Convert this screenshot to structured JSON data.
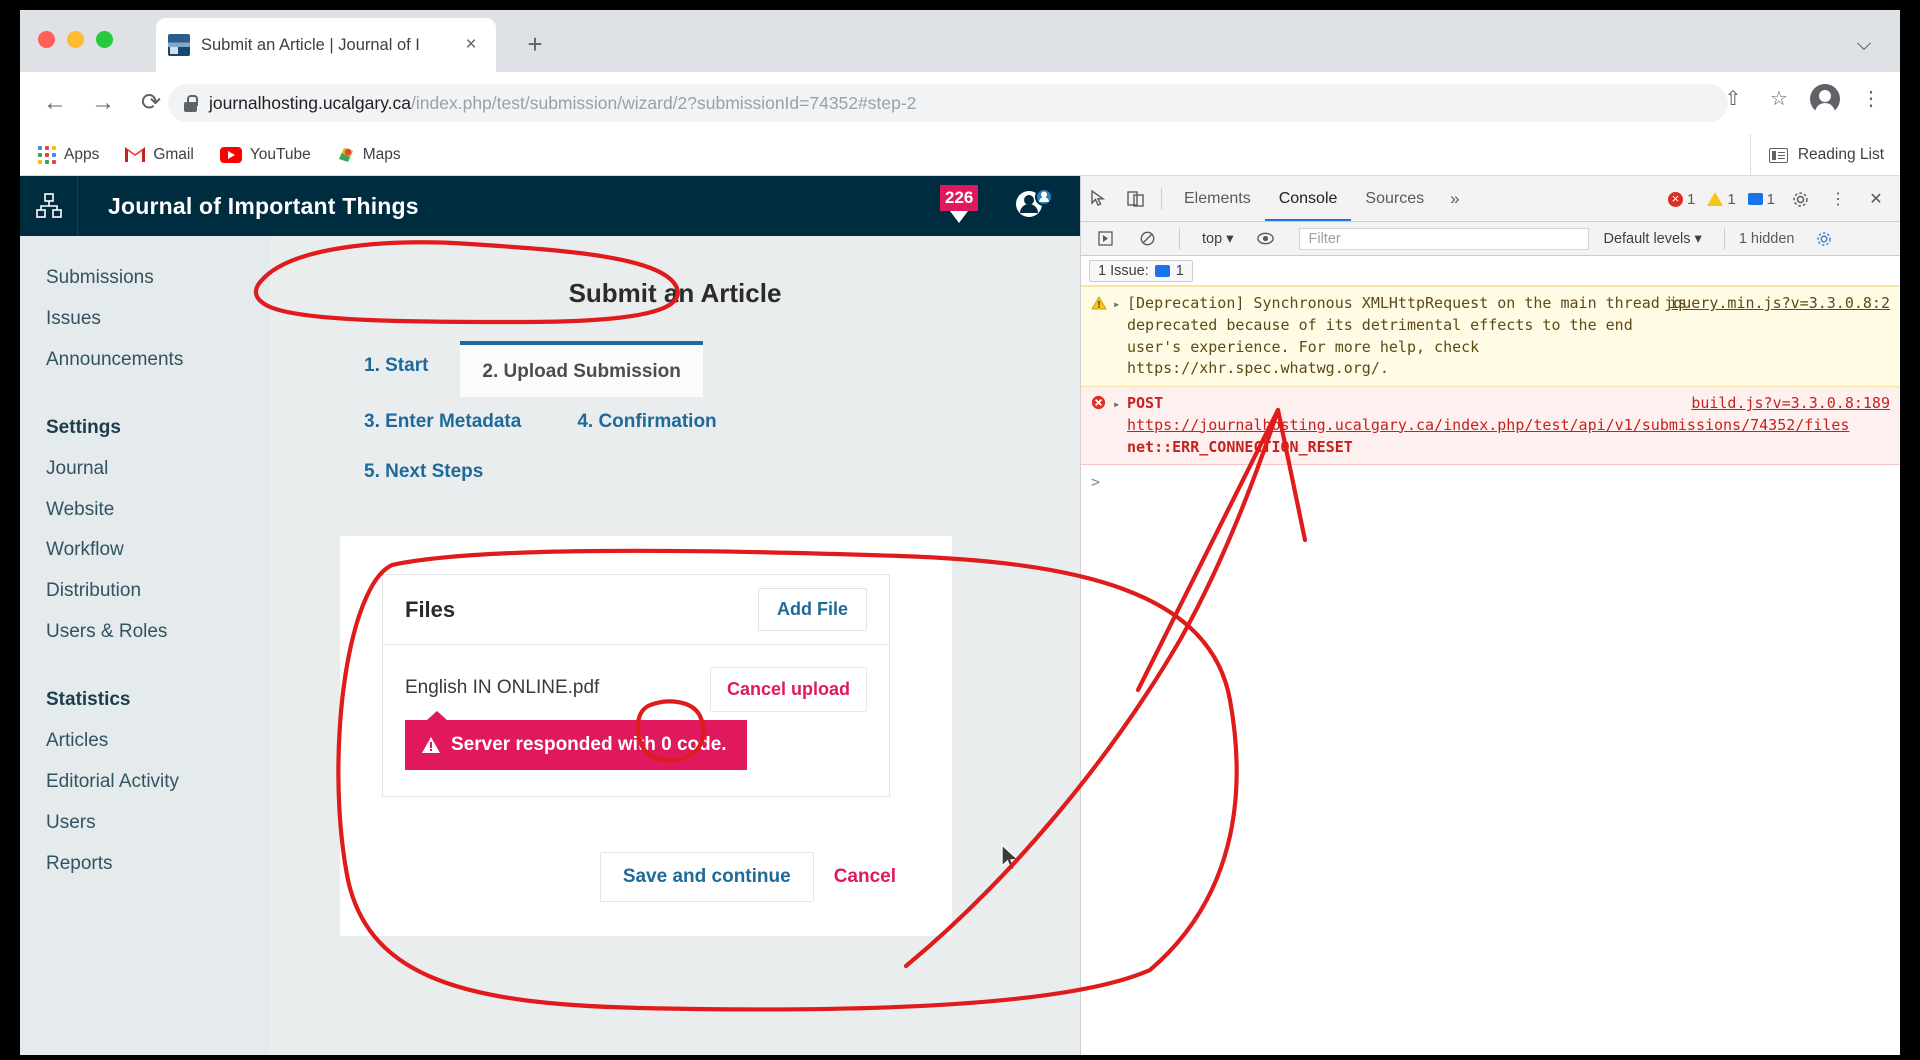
{
  "browser": {
    "tab": {
      "title": "Submit an Article | Journal of I",
      "favicon_name": "site-favicon",
      "close_label": "×"
    },
    "new_tab_label": "+",
    "tabstrip_chevron": "⌵",
    "nav": {
      "back": "←",
      "forward": "→",
      "reload": "⟳"
    },
    "url": {
      "host": "journalhosting.ucalgary.ca",
      "path": "/index.php/test/submission/wizard/2?submissionId=74352#step-2",
      "full": "journalhosting.ucalgary.ca/index.php/test/submission/wizard/2?submissionId=74352#step-2"
    },
    "toolbar_icons": {
      "share": "⇧",
      "bookmark": "☆",
      "menu": "⋮",
      "profile_name": "profile-avatar"
    },
    "bookmarks": [
      {
        "label": "Apps",
        "icon": "apps-grid-icon"
      },
      {
        "label": "Gmail",
        "icon": "gmail-icon"
      },
      {
        "label": "YouTube",
        "icon": "youtube-icon"
      },
      {
        "label": "Maps",
        "icon": "maps-icon"
      }
    ],
    "reading_list": {
      "label": "Reading List",
      "icon": "reading-list-icon"
    }
  },
  "ojs": {
    "header": {
      "logo_name": "ojs-logo-icon",
      "title": "Journal of Important Things",
      "notifications_count": "226",
      "user_icon_name": "user-account-icon"
    },
    "sidebar": [
      {
        "type": "item",
        "label": "Submissions"
      },
      {
        "type": "item",
        "label": "Issues"
      },
      {
        "type": "item",
        "label": "Announcements"
      },
      {
        "type": "gap"
      },
      {
        "type": "head",
        "label": "Settings"
      },
      {
        "type": "item",
        "label": "Journal"
      },
      {
        "type": "item",
        "label": "Website"
      },
      {
        "type": "item",
        "label": "Workflow"
      },
      {
        "type": "item",
        "label": "Distribution"
      },
      {
        "type": "item",
        "label": "Users & Roles"
      },
      {
        "type": "gap"
      },
      {
        "type": "head",
        "label": "Statistics"
      },
      {
        "type": "item",
        "label": "Articles"
      },
      {
        "type": "item",
        "label": "Editorial Activity"
      },
      {
        "type": "item",
        "label": "Users"
      },
      {
        "type": "item",
        "label": "Reports"
      }
    ],
    "page_title": "Submit an Article",
    "wizard_steps": [
      {
        "label": "1. Start",
        "active": false
      },
      {
        "label": "2. Upload Submission",
        "active": true
      },
      {
        "label": "3. Enter Metadata",
        "active": false
      },
      {
        "label": "4. Confirmation",
        "active": false
      },
      {
        "label": "5. Next Steps",
        "active": false
      }
    ],
    "files_card": {
      "title": "Files",
      "add_file_label": "Add File",
      "file_name": "English IN ONLINE.pdf",
      "cancel_upload_label": "Cancel upload",
      "error_message": "Server responded with 0 code.",
      "error_icon": "warning-triangle-icon",
      "error_color": "#e0195f"
    },
    "actions": {
      "save_label": "Save and continue",
      "cancel_label": "Cancel"
    }
  },
  "devtools": {
    "toolbar_icons": {
      "inspect": "inspect-element-icon",
      "device": "device-toolbar-icon",
      "settings": "gear-icon",
      "more": "kebab-menu-icon",
      "close": "close-icon"
    },
    "tabs": [
      {
        "label": "Elements",
        "active": false
      },
      {
        "label": "Console",
        "active": true
      },
      {
        "label": "Sources",
        "active": false
      }
    ],
    "more_tabs": "»",
    "counters": {
      "errors": "1",
      "warnings": "1",
      "messages": "1"
    },
    "filter": {
      "execute_icon": "execute-icon",
      "clear_icon": "clear-console-icon",
      "context": "top",
      "eye_icon": "live-expression-icon",
      "placeholder": "Filter",
      "levels": "Default levels",
      "hidden_text": "1 hidden",
      "settings_icon": "gear-icon"
    },
    "issue_bar": {
      "label": "1 Issue:",
      "count": "1",
      "icon": "issue-icon"
    },
    "messages": [
      {
        "type": "warning",
        "text": "[Deprecation] Synchronous XMLHttpRequest on the main thread is deprecated because of its detrimental effects to the end user's experience. For more help, check https://xhr.spec.whatwg.org/.",
        "link": "https://xhr.spec.whatwg.org/",
        "source": "jquery.min.js?v=3.3.0.8:2"
      },
      {
        "type": "error",
        "method": "POST",
        "url": "https://journalhosting.ucalgary.ca/index.php/test/api/v1/submissions/74352/files",
        "status": "net::ERR_CONNECTION_RESET",
        "source": "build.js?v=3.3.0.8:189"
      }
    ],
    "prompt": ">"
  },
  "annotations": {
    "color": "#e01b1b",
    "shapes": [
      "ellipse-around-page-title",
      "ellipse-around-files-panel",
      "circle-around-pdf-extension",
      "arrow-to-post-error"
    ]
  }
}
